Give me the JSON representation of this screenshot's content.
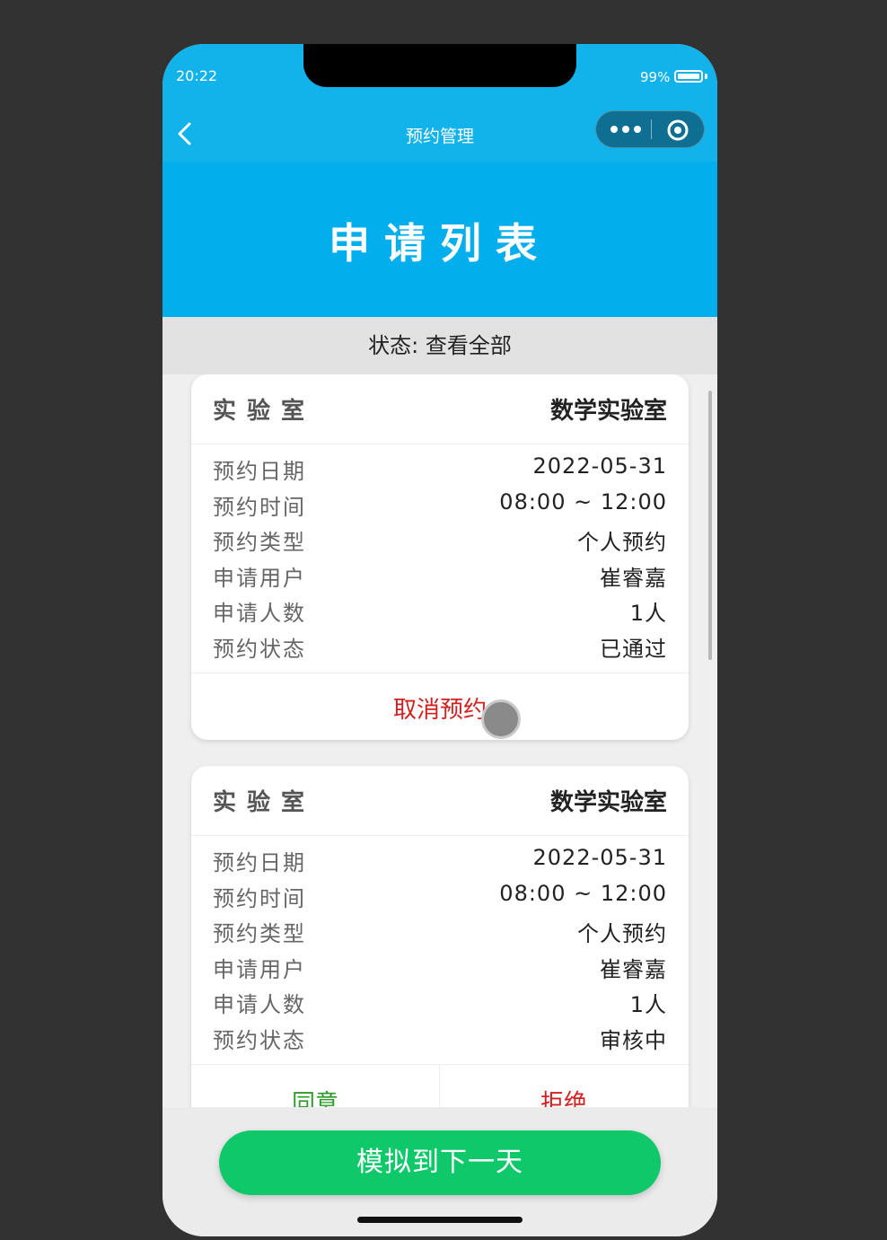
{
  "status_bar": {
    "time": "20:22",
    "battery": "99%"
  },
  "navbar": {
    "title": "预约管理"
  },
  "banner": {
    "title": "申请列表"
  },
  "filter": {
    "label": "状态: 查看全部"
  },
  "cards": [
    {
      "lab_label": "实验室",
      "lab_value": "数学实验室",
      "rows": [
        {
          "key": "预约日期",
          "value": "2022-05-31"
        },
        {
          "key": "预约时间",
          "value": "08:00 ~ 12:00"
        },
        {
          "key": "预约类型",
          "value": "个人预约"
        },
        {
          "key": "申请用户",
          "value": "崔睿嘉"
        },
        {
          "key": "申请人数",
          "value": "1人"
        },
        {
          "key": "预约状态",
          "value": "已通过"
        }
      ],
      "action": "取消预约"
    },
    {
      "lab_label": "实验室",
      "lab_value": "数学实验室",
      "rows": [
        {
          "key": "预约日期",
          "value": "2022-05-31"
        },
        {
          "key": "预约时间",
          "value": "08:00 ~ 12:00"
        },
        {
          "key": "预约类型",
          "value": "个人预约"
        },
        {
          "key": "申请用户",
          "value": "崔睿嘉"
        },
        {
          "key": "申请人数",
          "value": "1人"
        },
        {
          "key": "预约状态",
          "value": "审核中"
        }
      ],
      "agree": "同意",
      "reject": "拒绝"
    }
  ],
  "bottom": {
    "button": "模拟到下一天"
  },
  "colors": {
    "primary": "#03aeed",
    "success": "#0fc86a",
    "danger": "#d32020",
    "agree": "#2a9a2a"
  },
  "icons": [
    "back-icon",
    "more-icon",
    "target-icon"
  ]
}
